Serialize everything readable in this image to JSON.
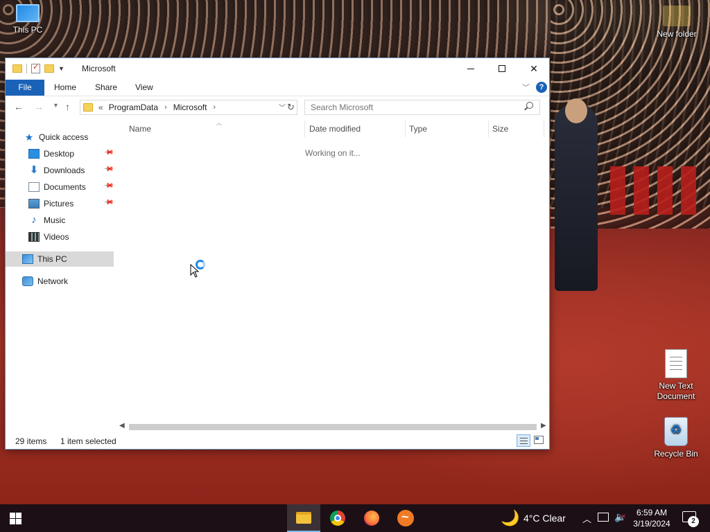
{
  "desktop": {
    "icons": [
      {
        "label": "This PC"
      },
      {
        "label": "New folder"
      },
      {
        "label": "New Text Document"
      },
      {
        "label": "Recycle Bin"
      }
    ]
  },
  "window": {
    "title": "Microsoft",
    "ribbon": {
      "file": "File",
      "home": "Home",
      "share": "Share",
      "view": "View",
      "help": "?"
    },
    "address": {
      "overflow": "«",
      "crumbs": [
        "ProgramData",
        "Microsoft"
      ]
    },
    "search": {
      "placeholder": "Search Microsoft"
    },
    "nav": {
      "quick_access": "Quick access",
      "items": [
        {
          "label": "Desktop",
          "pinned": true
        },
        {
          "label": "Downloads",
          "pinned": true
        },
        {
          "label": "Documents",
          "pinned": true
        },
        {
          "label": "Pictures",
          "pinned": true
        },
        {
          "label": "Music",
          "pinned": false
        },
        {
          "label": "Videos",
          "pinned": false
        }
      ],
      "this_pc": "This PC",
      "network": "Network",
      "selected": "This PC"
    },
    "columns": [
      "Name",
      "Date modified",
      "Type",
      "Size"
    ],
    "loading_text": "Working on it...",
    "status": {
      "item_count": "29 items",
      "selection": "1 item selected"
    }
  },
  "taskbar": {
    "apps": [
      "File Explorer",
      "Google Chrome",
      "Firefox",
      "App"
    ],
    "active_app": "File Explorer",
    "weather": "4°C  Clear",
    "time": "6:59 AM",
    "date": "3/19/2024",
    "notifications": "2"
  },
  "colors": {
    "accent": "#1a62b8",
    "selection": "#d9d9d9",
    "taskbar": "#0c0e16"
  },
  "icons": [
    "folder-icon",
    "pin-icon",
    "star-icon",
    "search-icon",
    "refresh-icon",
    "chevron-down-icon",
    "back-arrow-icon",
    "forward-arrow-icon",
    "up-arrow-icon",
    "minimize-icon",
    "maximize-icon",
    "close-icon",
    "moon-icon",
    "network-icon",
    "volume-muted-icon",
    "notification-icon"
  ]
}
